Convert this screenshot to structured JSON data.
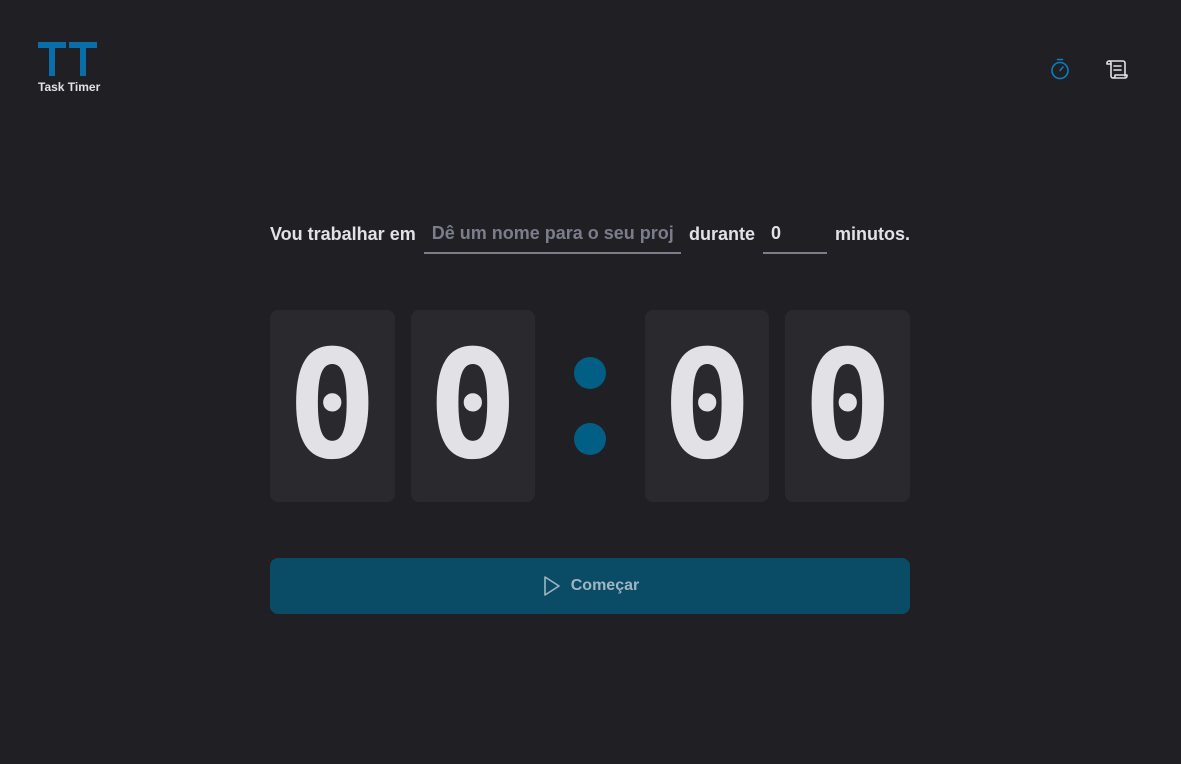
{
  "app": {
    "logo_text": "Task Timer",
    "logo_letters": "TT"
  },
  "nav": [
    {
      "icon": "timer-icon",
      "active": true
    },
    {
      "icon": "scroll-history-icon",
      "active": false
    }
  ],
  "form": {
    "label_work": "Vou trabalhar em",
    "task_placeholder": "Dê um nome para o seu projeto",
    "task_value": "",
    "label_during": "durante",
    "minutes_value": "0",
    "label_minutes": "minutos."
  },
  "countdown": {
    "minute_tens": "0",
    "minute_units": "0",
    "separator": ":",
    "second_tens": "0",
    "second_units": "0"
  },
  "actions": {
    "start_label": "Começar",
    "start_icon": "play-icon"
  },
  "colors": {
    "background": "#202024",
    "accent": "#00875f",
    "brand": "#015f85",
    "button": "#0a4b66",
    "digit_bg": "#29292e",
    "text": "#e1e1e6",
    "placeholder": "#7c7c8a"
  }
}
